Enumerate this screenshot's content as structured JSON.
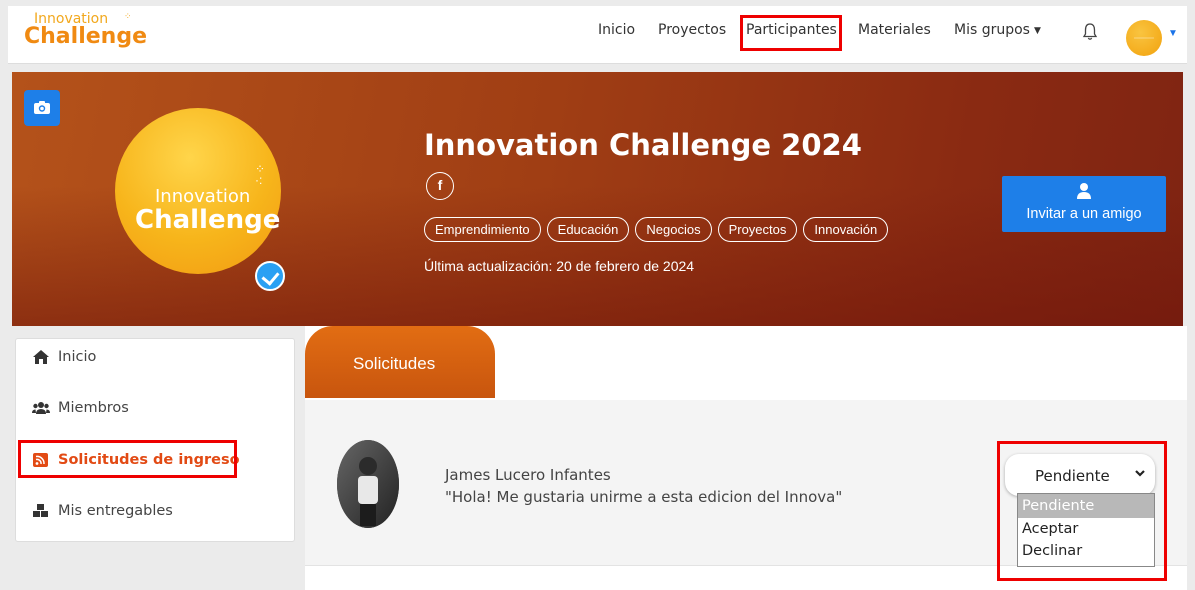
{
  "brand": {
    "logo_line1": "Innovation",
    "logo_line2": "Challenge"
  },
  "nav": {
    "items": [
      "Inicio",
      "Proyectos",
      "Participantes",
      "Materiales",
      "Mis grupos"
    ],
    "highlighted": "Participantes"
  },
  "group": {
    "title": "Innovation Challenge 2024",
    "social": "f",
    "tags": [
      "Emprendimiento",
      "Educación",
      "Negocios",
      "Proyectos",
      "Innovación"
    ],
    "updated": "Última actualización: 20 de febrero de 2024",
    "logo_line1": "Innovation",
    "logo_line2": "Challenge",
    "invite_label": "Invitar a un amigo"
  },
  "sidebar": {
    "items": [
      {
        "label": "Inicio",
        "icon": "home-icon"
      },
      {
        "label": "Miembros",
        "icon": "users-icon"
      },
      {
        "label": "Solicitudes de ingreso",
        "icon": "rss-icon",
        "active": true
      },
      {
        "label": "Mis entregables",
        "icon": "cubes-icon"
      }
    ]
  },
  "tab": {
    "label": "Solicitudes"
  },
  "request": {
    "name": "James Lucero Infantes",
    "message": "\"Hola! Me gustaria unirme a esta edicion del Innova\"",
    "status": "Pendiente",
    "options": [
      "Pendiente",
      "Aceptar",
      "Declinar"
    ]
  },
  "colors": {
    "accent": "#e26d13",
    "primary": "#1e7fe8",
    "highlight": "#ee0000",
    "cover": "#a03e14"
  }
}
